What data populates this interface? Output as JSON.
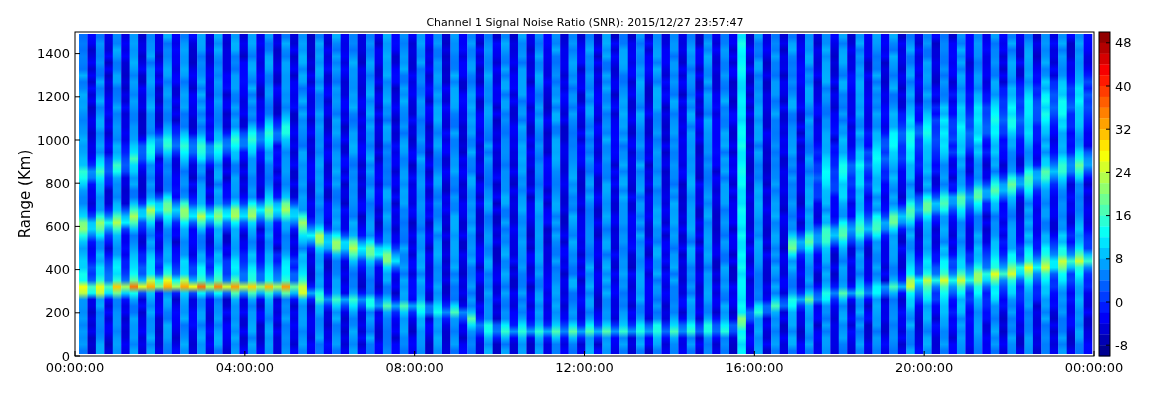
{
  "title": "Channel 1 Signal Noise Ratio (SNR): 2015/12/27 23:57:47",
  "y_axis": {
    "label": "Range (Km)",
    "ticks": [
      "1400",
      "1200",
      "1000",
      "800",
      "600",
      "400",
      "200",
      "0"
    ]
  },
  "x_axis": {
    "ticks": [
      "00:00:00",
      "04:00:00",
      "08:00:00",
      "12:00:00",
      "16:00:00",
      "20:00:00",
      "00:00:00"
    ]
  },
  "colorbar": {
    "ticks": [
      "48",
      "40",
      "32",
      "24",
      "16",
      "8",
      "0",
      "-8"
    ]
  }
}
